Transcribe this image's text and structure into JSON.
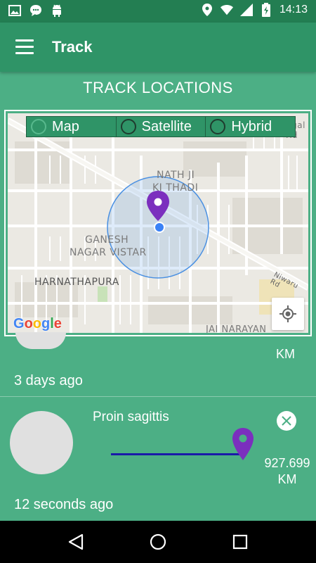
{
  "status_bar": {
    "time": "14:13",
    "icons": [
      "image-icon",
      "chat-bubble-icon",
      "android-icon",
      "location-icon",
      "wifi-icon",
      "signal-icon",
      "battery-charging-icon"
    ]
  },
  "app_bar": {
    "title": "Track",
    "menu_icon": "menu-icon"
  },
  "section": {
    "title": "TRACK LOCATIONS"
  },
  "map": {
    "map_types": [
      {
        "label": "Map",
        "selected": true
      },
      {
        "label": "Satellite",
        "selected": false
      },
      {
        "label": "Hybrid",
        "selected": false
      }
    ],
    "labels": {
      "nath_ji_1": "NATH JI",
      "nath_ji_2": "KI THADI",
      "ganesh_1": "GANESH",
      "ganesh_2": "NAGAR VISTAR",
      "harnathapura": "HARNATHAPURA",
      "jai_narayan": "JAI NARAYAN",
      "niwaru_rd": "Niwaru Rd",
      "top_rd": "ngal Rd"
    },
    "logo": "Google",
    "locate_icon": "my-location-icon",
    "colors": {
      "marker": "#7b2fbe",
      "accuracy_circle": "#4a90e2",
      "user_dot": "#3b82f6"
    }
  },
  "tracked_items": [
    {
      "name": "",
      "distance": "",
      "unit": "KM",
      "time_ago": "3 days ago"
    },
    {
      "name": "Proin sagittis",
      "distance": "927.699",
      "unit": "KM",
      "time_ago": "12 seconds ago"
    }
  ],
  "nav_bar": {
    "buttons": [
      "back-icon",
      "home-icon",
      "recents-icon"
    ]
  },
  "colors": {
    "status_bar": "#237e52",
    "app_bar": "#2f9467",
    "background": "#4caf85",
    "progress": "#1a1aa8"
  }
}
